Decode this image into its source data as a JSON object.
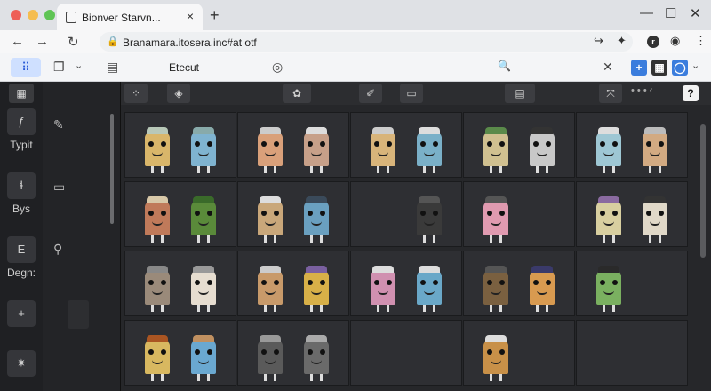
{
  "window": {
    "tab_title": "Bionver Starvn...",
    "tab_close": "×",
    "new_tab": "+",
    "min": "—",
    "max": "☐",
    "close": "✕",
    "colors": {
      "red": "#ee5f57",
      "yellow": "#f5bd4f",
      "green": "#5fc454"
    }
  },
  "address": {
    "back": "←",
    "forward": "→",
    "reload": "↻",
    "lock": "🔒",
    "url": "Branamara.itosera.inc#at otf",
    "share": "↪",
    "extensions": "✦",
    "profile_letter": "r",
    "record": "◉",
    "menu": "⋮"
  },
  "ext_toolbar": {
    "apps": "⠿",
    "tabs": "❐",
    "tabs_chevron": "⌄",
    "reader": "▤",
    "label": "Etecut",
    "shield": "◎",
    "search": "🔍",
    "clear": "✕",
    "add": "+",
    "calc": "▦",
    "profile": "◯",
    "profile_chevron": "⌄"
  },
  "rail": {
    "top_icon": "▦",
    "items": [
      {
        "icon": "ƒ",
        "label": "Typit"
      },
      {
        "icon": "ɬ",
        "label": "Bys"
      },
      {
        "icon": "E",
        "label": "Degn:"
      },
      {
        "icon": "+",
        "label": ""
      },
      {
        "icon": "✷",
        "label": ""
      }
    ]
  },
  "panel": {
    "icons": [
      "✎",
      "▭",
      "⚲"
    ]
  },
  "app_top": {
    "chips": [
      "⁘",
      "◈",
      "✿",
      "✐",
      "▭",
      "▤",
      "⤧"
    ],
    "dots": "• • • ‹",
    "help": "?"
  },
  "monsters": [
    [
      [
        {
          "c": "#d9b66a",
          "h": "#b8c8b8"
        },
        {
          "c": "#7fb3d0",
          "h": "#8aa"
        }
      ],
      [
        {
          "c": "#d9a07a",
          "h": "#ccc"
        },
        {
          "c": "#c7a089",
          "h": "#ddd"
        }
      ],
      [
        {
          "c": "#d8b47a",
          "h": "#ccc"
        },
        {
          "c": "#7ab0c8",
          "h": "#ddd"
        }
      ],
      [
        {
          "c": "#d0c090",
          "h": "#5a8a4a"
        },
        {
          "c": "#c8c8c8",
          "h": "#333"
        }
      ],
      [
        {
          "c": "#9ec7d4",
          "h": "#ddd"
        },
        {
          "c": "#d2aa82",
          "h": "#bbb"
        }
      ]
    ],
    [
      [
        {
          "c": "#c07a5a",
          "h": "#d8c8a8"
        },
        {
          "c": "#5a8a3a",
          "h": "#3a6a2a"
        }
      ],
      [
        {
          "c": "#c9a77a",
          "h": "#ddd"
        },
        {
          "c": "#6aa0c0",
          "h": "#3a4a5a"
        }
      ],
      [
        {
          "c": "#2e2f33",
          "h": "#2e2f33"
        },
        {
          "c": "#3a3a3a",
          "h": "#555"
        }
      ],
      [
        {
          "c": "#e09ab0",
          "h": "#555"
        },
        {
          "c": "#2e2f33",
          "h": "#2e2f33"
        }
      ],
      [
        {
          "c": "#d8cfa0",
          "h": "#8a6aa0"
        },
        {
          "c": "#e0d8c8",
          "h": "#333"
        }
      ]
    ],
    [
      [
        {
          "c": "#9a8a7a",
          "h": "#888"
        },
        {
          "c": "#e6ddd0",
          "h": "#999"
        }
      ],
      [
        {
          "c": "#c89a6a",
          "h": "#ccc"
        },
        {
          "c": "#d8b048",
          "h": "#7a60a0"
        }
      ],
      [
        {
          "c": "#d090b0",
          "h": "#ddd"
        },
        {
          "c": "#6aa8c8",
          "h": "#ddd"
        }
      ],
      [
        {
          "c": "#7a6040",
          "h": "#555"
        },
        {
          "c": "#d89a50",
          "h": "#3a3a6a"
        }
      ],
      [
        {
          "c": "#7ab060",
          "h": "#2a2a2a"
        },
        {
          "c": "#2e2f33",
          "h": "#2e2f33"
        }
      ]
    ],
    [
      [
        {
          "c": "#d8b860",
          "h": "#aa5522"
        },
        {
          "c": "#6aa8d0",
          "h": "#c09060"
        }
      ],
      [
        {
          "c": "#5a5a5a",
          "h": "#999"
        },
        {
          "c": "#6a6a6a",
          "h": "#aaa"
        }
      ],
      [
        {
          "c": "#2e2f33",
          "h": "#ddd"
        },
        {
          "c": "#2e2f33",
          "h": "#ddd"
        }
      ],
      [
        {
          "c": "#c89048",
          "h": "#ddd"
        },
        {
          "c": "#2e2f33",
          "h": "#2e2f33"
        }
      ],
      [
        {
          "c": "#2e2f33",
          "h": "#2e2f33"
        },
        {
          "c": "#2e2f33",
          "h": "#2e2f33"
        }
      ]
    ]
  ]
}
